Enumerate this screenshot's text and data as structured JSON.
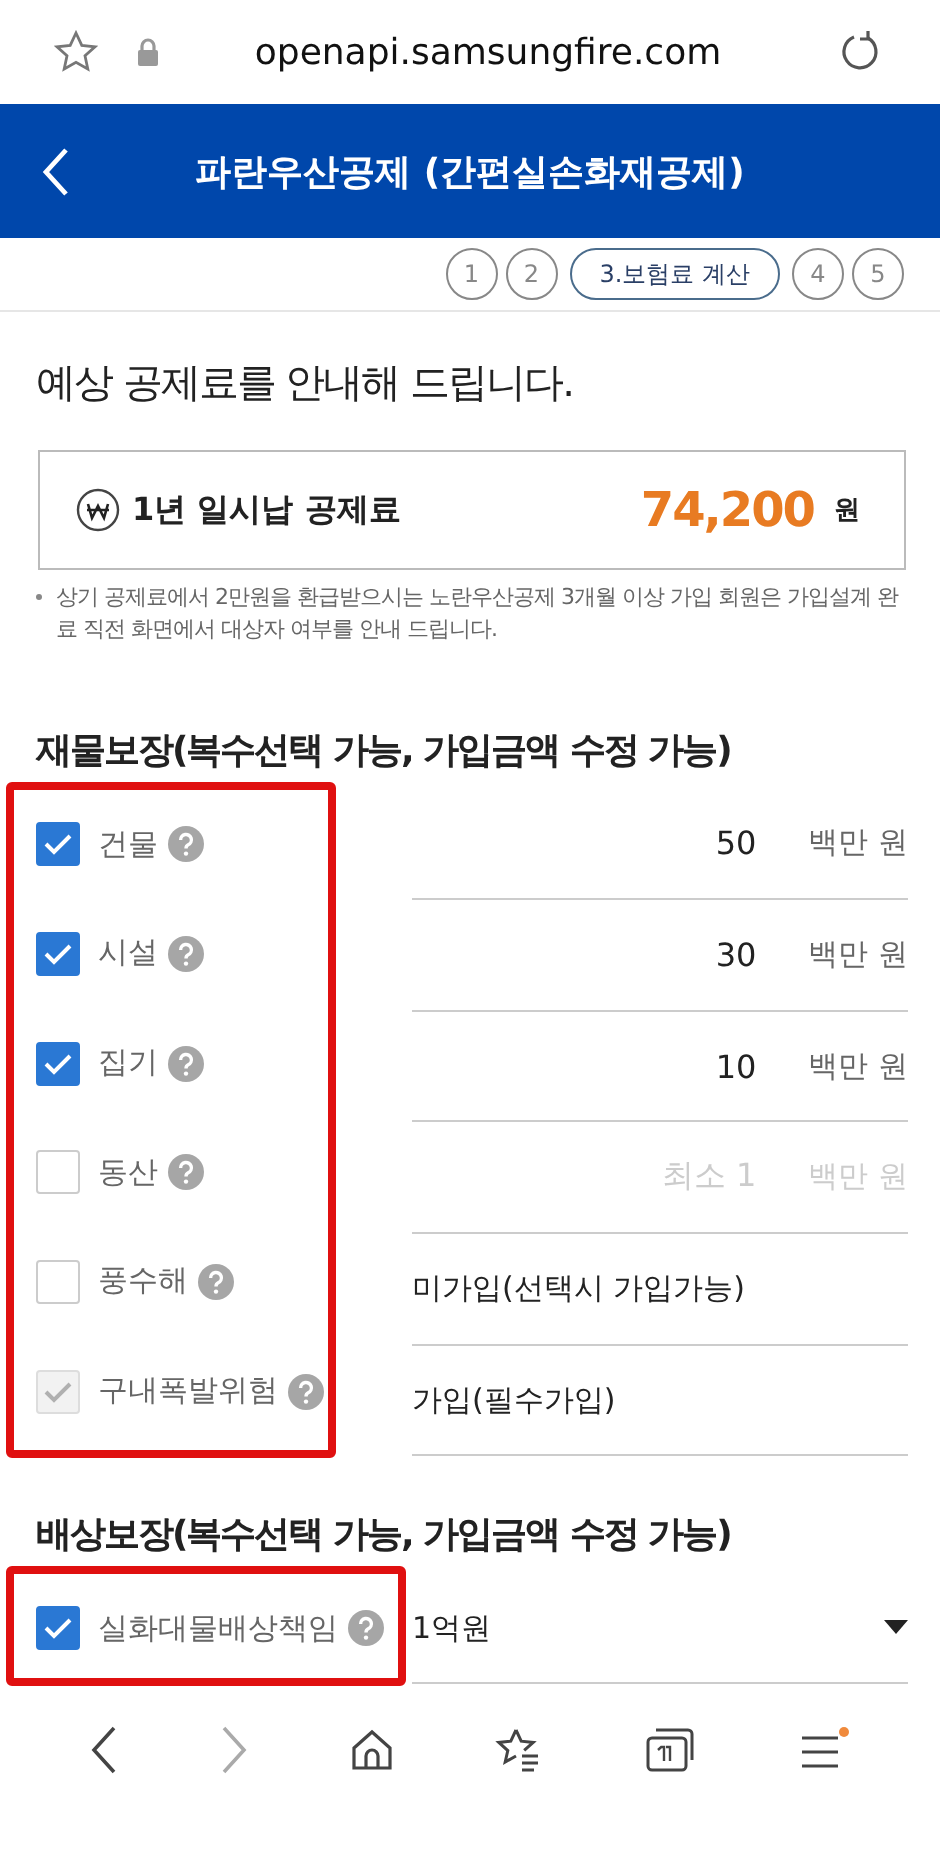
{
  "browser": {
    "url": "openapi.samsungfire.com"
  },
  "header": {
    "title": "파란우산공제 (간편실손화재공제)"
  },
  "steps": [
    {
      "label": "1",
      "selected": false
    },
    {
      "label": "2",
      "selected": false
    },
    {
      "label": "3.보험료 계산",
      "selected": true
    },
    {
      "label": "4",
      "selected": false
    },
    {
      "label": "5",
      "selected": false
    }
  ],
  "heading": "예상 공제료를 안내해 드립니다.",
  "premium": {
    "label": "1년 일시납 공제료",
    "amount": "74,200",
    "unit": "원"
  },
  "note": "상기 공제료에서 2만원을 환급받으시는 노란우산공제 3개월 이상 가입 회원은 가입설계 완료 직전 화면에서 대상자 여부를 안내 드립니다.",
  "property_coverage": {
    "title": "재물보장(복수선택 가능, 가입금액 수정 가능)",
    "highlighted": true,
    "items": [
      {
        "label": "건물",
        "checked": true,
        "disabled": false,
        "kind": "amount",
        "value": "50",
        "unit": "백만 원"
      },
      {
        "label": "시설",
        "checked": true,
        "disabled": false,
        "kind": "amount",
        "value": "30",
        "unit": "백만 원"
      },
      {
        "label": "집기",
        "checked": true,
        "disabled": false,
        "kind": "amount",
        "value": "10",
        "unit": "백만 원"
      },
      {
        "label": "동산",
        "checked": false,
        "disabled": false,
        "kind": "amount",
        "placeholder": "최소 1",
        "unit": "백만 원"
      },
      {
        "label": "풍수해",
        "checked": false,
        "disabled": false,
        "kind": "text",
        "text": "미가입(선택시 가입가능)"
      },
      {
        "label": "구내폭발위험",
        "checked": true,
        "disabled": true,
        "kind": "text",
        "text": "가입(필수가입)"
      }
    ]
  },
  "liability_coverage": {
    "title": "배상보장(복수선택 가능, 가입금액 수정 가능)",
    "highlighted": true,
    "items": [
      {
        "label": "실화대물배상책임",
        "checked": true,
        "disabled": false,
        "kind": "select",
        "value": "1억원"
      }
    ]
  }
}
